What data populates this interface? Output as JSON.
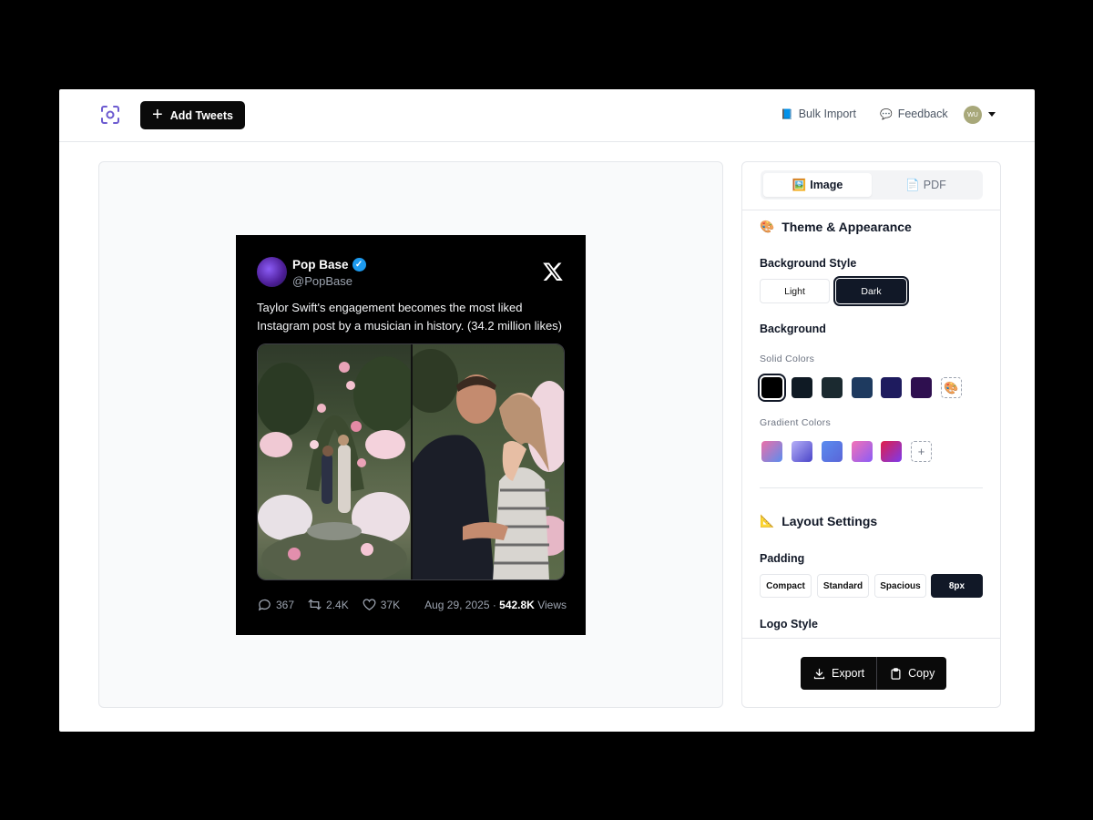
{
  "header": {
    "add_tweets_label": "Add Tweets",
    "bulk_import_label": "Bulk Import",
    "feedback_label": "Feedback",
    "avatar_initials": "WU"
  },
  "tweet": {
    "name": "Pop Base",
    "handle": "@PopBase",
    "text": "Taylor Swift's engagement becomes the most liked Instagram post by a musician in history. (34.2 million likes)",
    "replies": "367",
    "retweets": "2.4K",
    "likes": "37K",
    "date": "Aug 29, 2025 · ",
    "views_count": "542.8K",
    "views_label": " Views"
  },
  "panel": {
    "tabs": [
      {
        "icon": "🖼️",
        "label": "Image"
      },
      {
        "icon": "📄",
        "label": "PDF"
      }
    ],
    "theme_title": "Theme & Appearance",
    "background_style_label": "Background Style",
    "style_options": [
      "Light",
      "Dark"
    ],
    "selected_style": "Dark",
    "background_label": "Background",
    "solid_colors_label": "Solid Colors",
    "solid_colors": [
      "#000000",
      "#0f1a24",
      "#1b2a30",
      "#1e3a5f",
      "#1e1b5e",
      "#2e0f4f"
    ],
    "gradient_colors_label": "Gradient Colors",
    "gradients": [
      [
        "#ec6fa8",
        "#5b8def"
      ],
      [
        "#b6b0f7",
        "#4a45c9"
      ],
      [
        "#5b8def",
        "#5a65d8"
      ],
      [
        "#f472b6",
        "#8b5cf6"
      ],
      [
        "#e11d48",
        "#7c3aed"
      ]
    ],
    "layout_title": "Layout Settings",
    "padding_label": "Padding",
    "padding_options": [
      "Compact",
      "Standard",
      "Spacious",
      "8px"
    ],
    "selected_padding": "8px",
    "logo_style_label": "Logo Style",
    "export_label": "Export",
    "copy_label": "Copy"
  }
}
